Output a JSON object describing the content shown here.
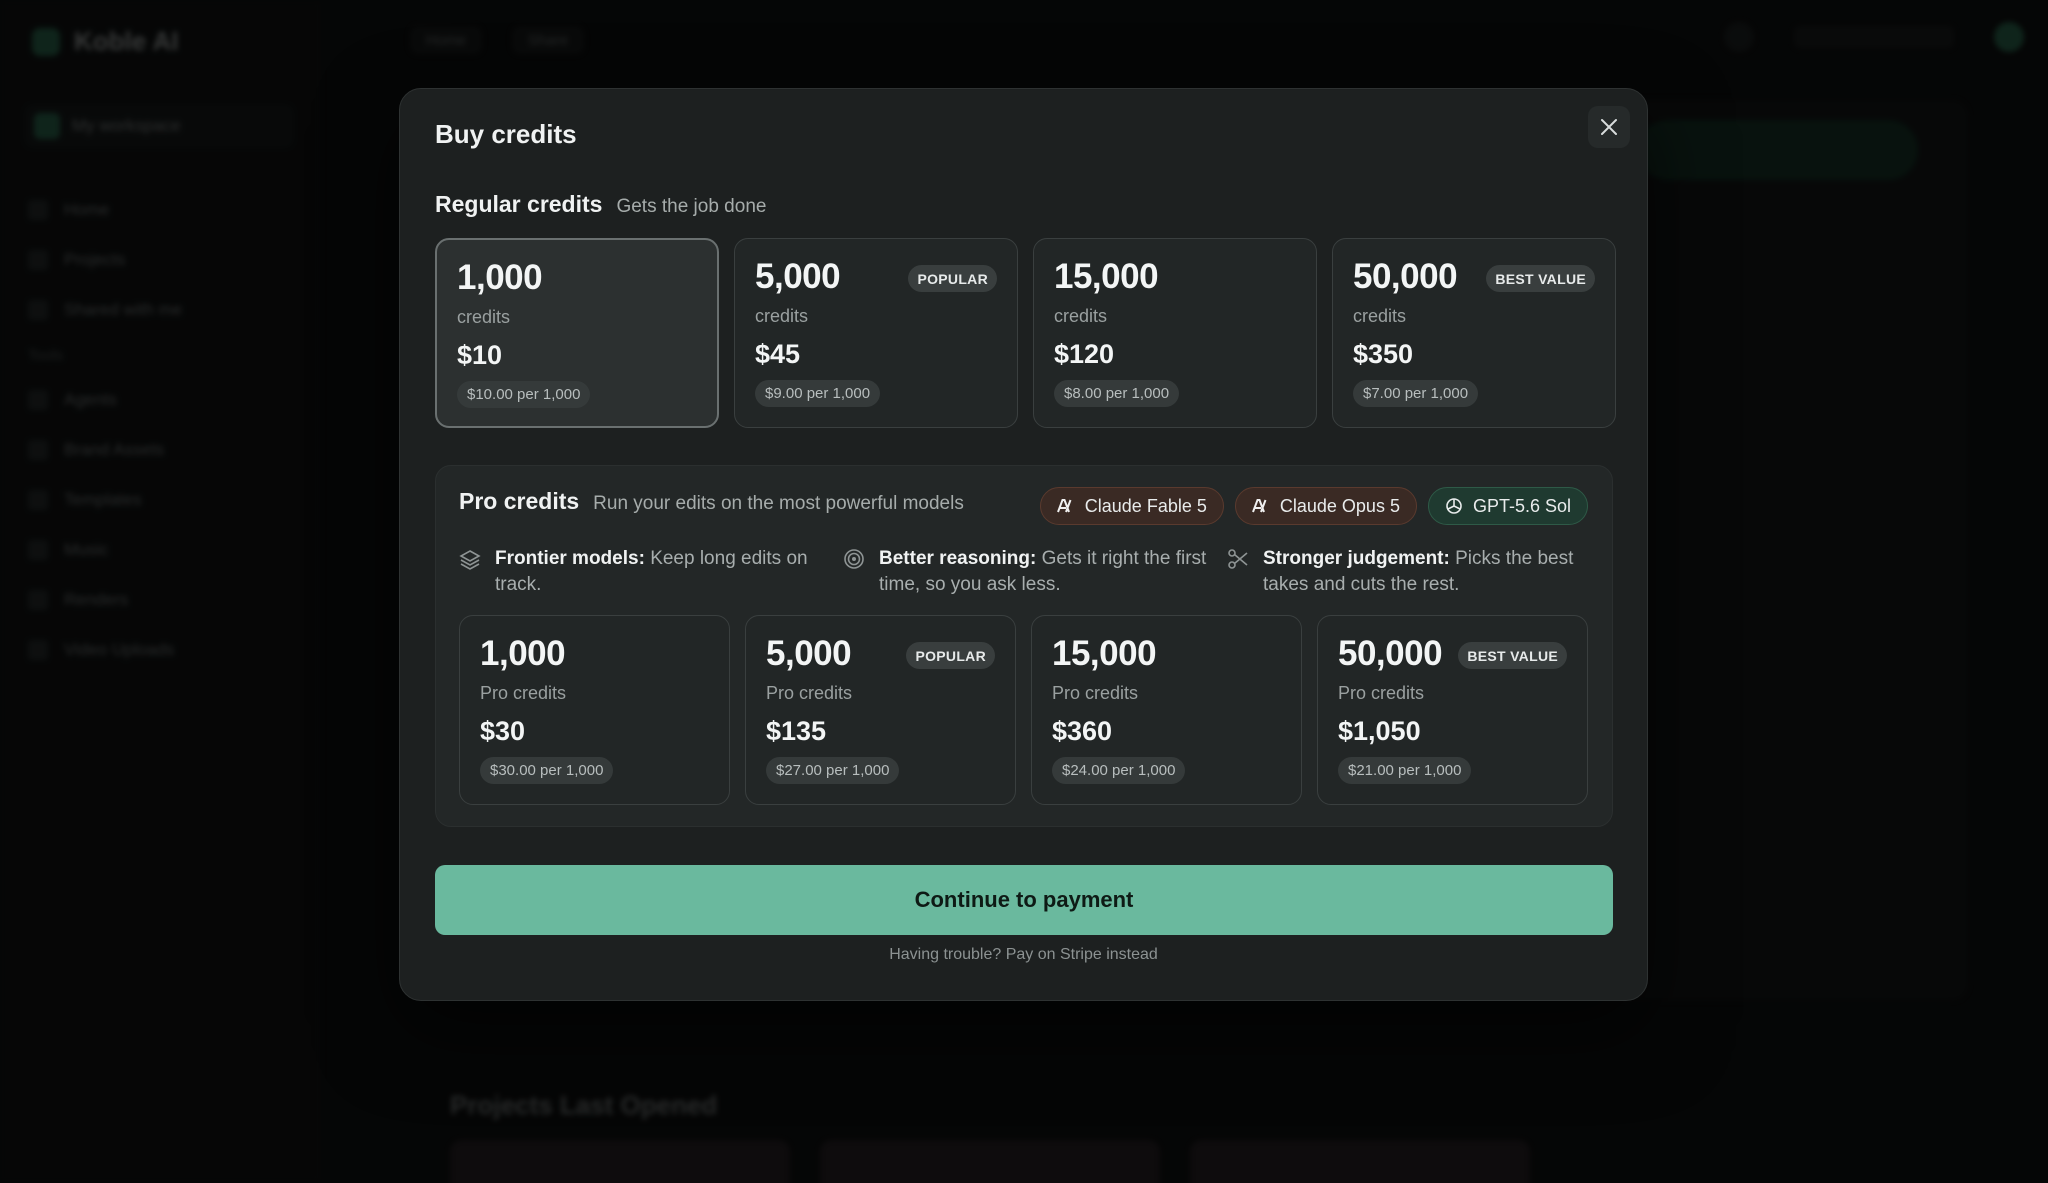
{
  "background": {
    "app_name": "Koble AI",
    "workspace": "My workspace",
    "nav": [
      "Home",
      "Projects",
      "Shared with me"
    ],
    "nav_section": "Tools",
    "tools": [
      "Agents",
      "Brand Assets",
      "Templates",
      "Music",
      "Renders",
      "Video Uploads"
    ],
    "top_chips": [
      "Home",
      "Share"
    ],
    "section": "Projects Last Opened"
  },
  "modal": {
    "title": "Buy credits",
    "close_icon": "close-icon"
  },
  "regular": {
    "title": "Regular credits",
    "subtitle": "Gets the job done",
    "options": [
      {
        "amount": "1,000",
        "unit": "credits",
        "price": "$10",
        "rate": "$10.00 per 1,000",
        "badge": "",
        "selected": true
      },
      {
        "amount": "5,000",
        "unit": "credits",
        "price": "$45",
        "rate": "$9.00 per 1,000",
        "badge": "POPULAR",
        "selected": false
      },
      {
        "amount": "15,000",
        "unit": "credits",
        "price": "$120",
        "rate": "$8.00 per 1,000",
        "badge": "",
        "selected": false
      },
      {
        "amount": "50,000",
        "unit": "credits",
        "price": "$350",
        "rate": "$7.00 per 1,000",
        "badge": "BEST VALUE",
        "selected": false
      }
    ]
  },
  "pro": {
    "title": "Pro credits",
    "subtitle": "Run your edits on the most powerful models",
    "models": [
      {
        "label": "Claude Fable 5",
        "icon": "anthropic-icon",
        "brand": "anthropic"
      },
      {
        "label": "Claude Opus 5",
        "icon": "anthropic-icon",
        "brand": "anthropic"
      },
      {
        "label": "GPT-5.6 Sol",
        "icon": "openai-icon",
        "brand": "openai"
      }
    ],
    "features": [
      {
        "icon": "layers-icon",
        "title": "Frontier models:",
        "text": "Keep long edits on track."
      },
      {
        "icon": "target-icon",
        "title": "Better reasoning:",
        "text": "Gets it right the first time, so you ask less."
      },
      {
        "icon": "scissors-icon",
        "title": "Stronger judgement:",
        "text": "Picks the best takes and cuts the rest."
      }
    ],
    "options": [
      {
        "amount": "1,000",
        "unit": "Pro credits",
        "price": "$30",
        "rate": "$30.00 per 1,000",
        "badge": ""
      },
      {
        "amount": "5,000",
        "unit": "Pro credits",
        "price": "$135",
        "rate": "$27.00 per 1,000",
        "badge": "POPULAR"
      },
      {
        "amount": "15,000",
        "unit": "Pro credits",
        "price": "$360",
        "rate": "$24.00 per 1,000",
        "badge": ""
      },
      {
        "amount": "50,000",
        "unit": "Pro credits",
        "price": "$1,050",
        "rate": "$21.00 per 1,000",
        "badge": "BEST VALUE"
      }
    ]
  },
  "cta": {
    "label": "Continue to payment",
    "trouble": "Having trouble? Pay on Stripe instead"
  },
  "colors": {
    "accent": "#6ab99e",
    "modal_bg": "#1d2020",
    "anthropic_pill": "#3a2a24",
    "openai_pill": "#1f3a30"
  }
}
